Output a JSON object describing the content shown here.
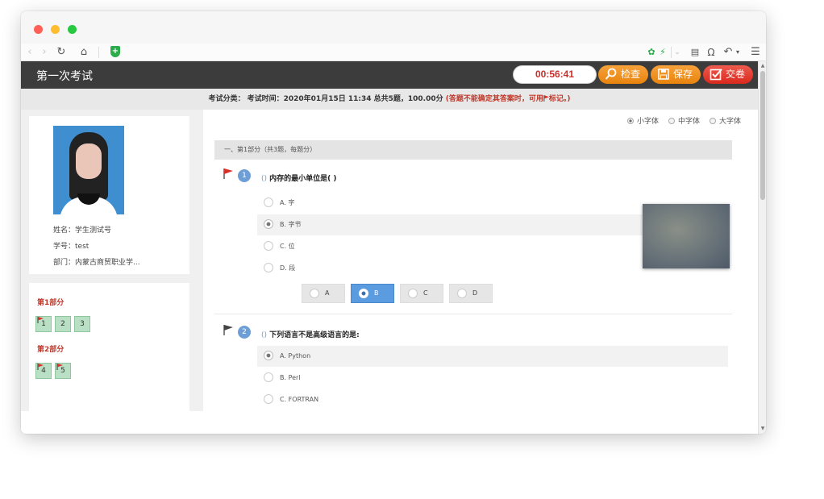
{
  "exam": {
    "title": "第一次考试",
    "timer": "00:56:41",
    "buttons": {
      "check": "检查",
      "save": "保存",
      "submit": "交卷"
    }
  },
  "infobar": {
    "main": "考试分类： 考试时间：2020年01月15日 11:34 总共5题，100.00分",
    "note_prefix": "(答题不能确定其答案时，可用",
    "note_suffix": "标记。)"
  },
  "student": {
    "name": "姓名：学生测试号",
    "id": "学号：test",
    "dept": "部门：内蒙古商贸职业学..."
  },
  "navigation": {
    "parts": [
      {
        "title": "第1部分",
        "questions": [
          "1",
          "2",
          "3"
        ]
      },
      {
        "title": "第2部分",
        "questions": [
          "4",
          "5"
        ]
      }
    ]
  },
  "font_size": {
    "options": [
      "小字体",
      "中字体",
      "大字体"
    ],
    "selected": "小字体"
  },
  "section": {
    "title": "一、第1部分（共3题，每题分）"
  },
  "questions": [
    {
      "number": "1",
      "paren": "()",
      "text": "内存的最小单位是(  )",
      "options": [
        "A. 字",
        "B. 字节",
        "C. 位",
        "D. 段"
      ],
      "selected": "B",
      "answer_buttons": [
        "A",
        "B",
        "C",
        "D"
      ]
    },
    {
      "number": "2",
      "paren": "()",
      "text": "下列语言不是高级语言的是:",
      "options": [
        "A. Python",
        "B. Perl",
        "C. FORTRAN"
      ],
      "selected": "A"
    }
  ],
  "colors": {
    "header_bg": "#3c3c3c",
    "accent_orange": "#f09a2a",
    "accent_red": "#e03b2f",
    "question_blue": "#6d9fd6",
    "nav_green": "#b9e0c4"
  }
}
